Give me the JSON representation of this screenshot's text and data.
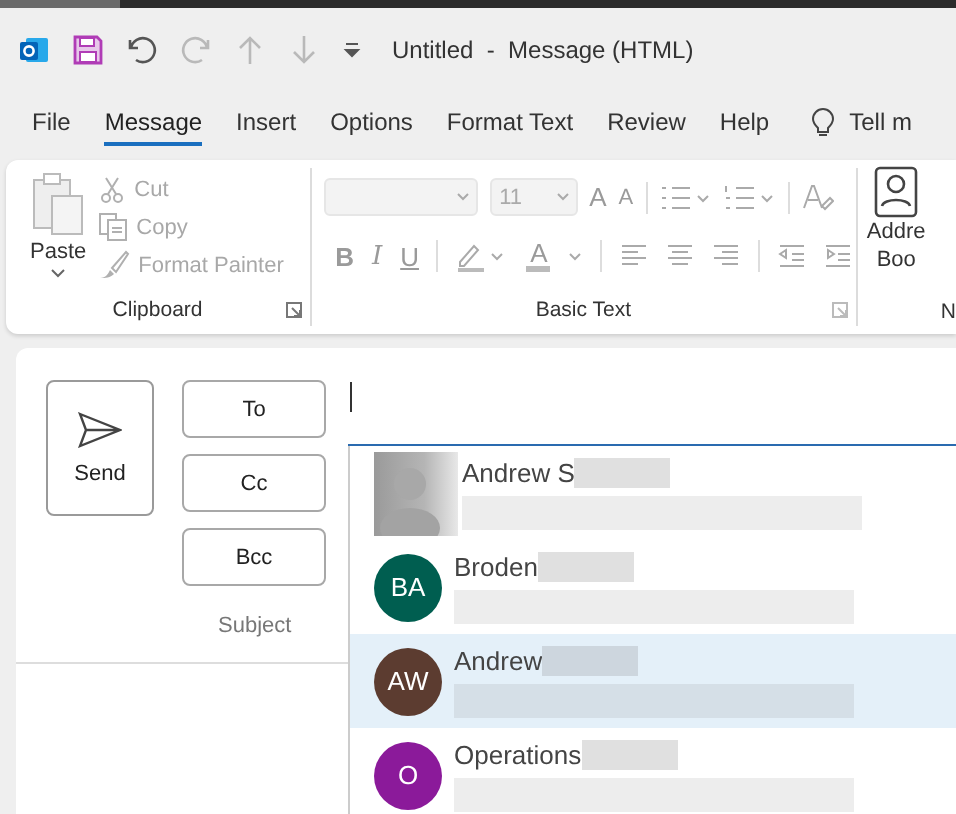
{
  "title_bar": {
    "title": "Untitled  -  Message (HTML)",
    "quick_access": [
      {
        "kind": "save"
      },
      {
        "kind": "undo",
        "disabled": false
      },
      {
        "kind": "redo",
        "disabled": true
      },
      {
        "kind": "up",
        "disabled": true
      },
      {
        "kind": "down",
        "disabled": true
      },
      {
        "kind": "customize"
      }
    ]
  },
  "tabs": [
    {
      "label": "File",
      "selected": false
    },
    {
      "label": "Message",
      "selected": true
    },
    {
      "label": "Insert",
      "selected": false
    },
    {
      "label": "Options",
      "selected": false
    },
    {
      "label": "Format Text",
      "selected": false
    },
    {
      "label": "Review",
      "selected": false
    },
    {
      "label": "Help",
      "selected": false
    }
  ],
  "tell_me": "Tell m",
  "ribbon": {
    "clipboard": {
      "paste": "Paste",
      "label": "Clipboard",
      "items": [
        {
          "kind": "cut",
          "label": "Cut",
          "disabled": true
        },
        {
          "kind": "copy",
          "label": "Copy",
          "disabled": true
        },
        {
          "kind": "format_painter",
          "label": "Format Painter",
          "disabled": true
        }
      ]
    },
    "basic_text": {
      "label": "Basic Text",
      "font_size": "11",
      "disabled": true,
      "grow_glyph": "A",
      "shrink_glyph": "A",
      "bold": "B",
      "italic": "I",
      "underline": "U",
      "font_color_glyph": "A"
    },
    "address_book": {
      "label_lines": [
        "Addre",
        "Boo"
      ]
    },
    "next_group_label": "N"
  },
  "compose": {
    "send": "Send",
    "recipient_buttons": [
      "To",
      "Cc",
      "Bcc"
    ],
    "subject_label": "Subject",
    "suggestions": [
      {
        "name": "Andrew S",
        "selected": false
      },
      {
        "name": "Broden",
        "avatar": {
          "kind": "initials",
          "initials": "BA",
          "color": "#005e50"
        },
        "selected": false
      },
      {
        "name": "Andrew",
        "avatar": {
          "kind": "initials",
          "initials": "AW",
          "color": "#5c3c30"
        },
        "selected": true
      },
      {
        "name": "Operations",
        "avatar": {
          "kind": "initials",
          "initials": "O",
          "color": "#8b1a9a"
        },
        "selected": false
      }
    ]
  }
}
